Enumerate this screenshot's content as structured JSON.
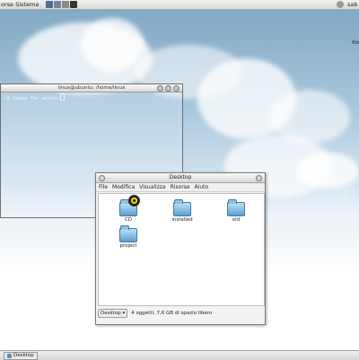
{
  "top_panel": {
    "menu_label": "orse Sistema",
    "user_label": "sab"
  },
  "desktop": {
    "corner_label": "Ho"
  },
  "terminal": {
    "title": "linux@ubuntu: /home/linux",
    "prompt_text": "~$ theme for winter"
  },
  "filemanager": {
    "title": "Desktop",
    "menu": [
      "File",
      "Modifica",
      "Visualizza",
      "Risorse",
      "Aiuto"
    ],
    "items": [
      {
        "label": "CD",
        "icon": "cd-folder-icon"
      },
      {
        "label": "installed",
        "icon": "folder-icon"
      },
      {
        "label": "old",
        "icon": "folder-icon"
      },
      {
        "label": "project",
        "icon": "folder-icon"
      }
    ],
    "location": "Desktop",
    "status": "4 oggetti, 7,6 GB di spazio libero"
  },
  "bottom_panel": {
    "task_label": "Desktop"
  }
}
